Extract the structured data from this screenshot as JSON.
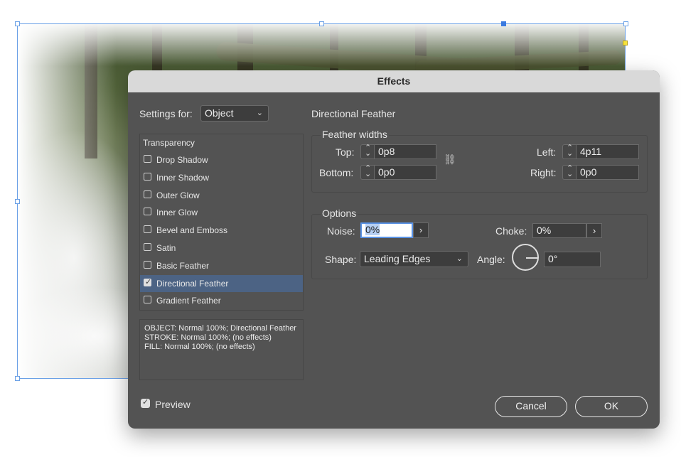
{
  "dialog": {
    "title": "Effects",
    "settings_for_label": "Settings for:",
    "settings_for_value": "Object",
    "section_title": "Directional Feather",
    "list_header": "Transparency",
    "effects": [
      {
        "label": "Drop Shadow",
        "checked": false
      },
      {
        "label": "Inner Shadow",
        "checked": false
      },
      {
        "label": "Outer Glow",
        "checked": false
      },
      {
        "label": "Inner Glow",
        "checked": false
      },
      {
        "label": "Bevel and Emboss",
        "checked": false
      },
      {
        "label": "Satin",
        "checked": false
      },
      {
        "label": "Basic Feather",
        "checked": false
      },
      {
        "label": "Directional Feather",
        "checked": true,
        "selected": true
      },
      {
        "label": "Gradient Feather",
        "checked": false
      }
    ],
    "summary_lines": [
      "OBJECT: Normal 100%; Directional Feather",
      "STROKE: Normal 100%; (no effects)",
      "FILL: Normal 100%; (no effects)"
    ],
    "feather_widths": {
      "title": "Feather widths",
      "top_label": "Top:",
      "top_value": "0p8",
      "bottom_label": "Bottom:",
      "bottom_value": "0p0",
      "left_label": "Left:",
      "left_value": "4p11",
      "right_label": "Right:",
      "right_value": "0p0",
      "link_icon": "broken-chain-icon"
    },
    "options": {
      "title": "Options",
      "noise_label": "Noise:",
      "noise_value": "0%",
      "choke_label": "Choke:",
      "choke_value": "0%",
      "shape_label": "Shape:",
      "shape_value": "Leading Edges",
      "angle_label": "Angle:",
      "angle_value": "0°"
    },
    "preview_label": "Preview",
    "preview_checked": true,
    "cancel_label": "Cancel",
    "ok_label": "OK"
  }
}
